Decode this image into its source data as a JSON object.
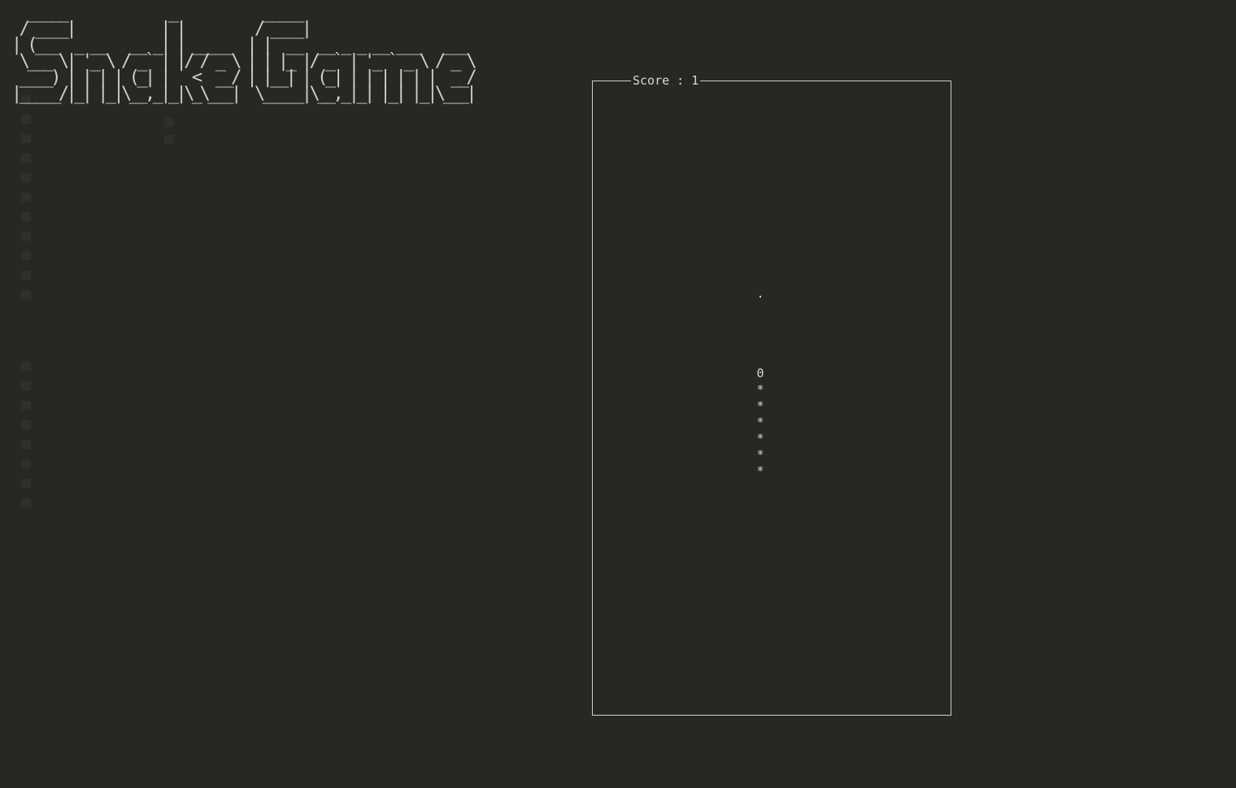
{
  "banner": {
    "ascii_art": "  _____             _           _____\n / ____|           | |         / ____|\n| (___  _ __   __ _| | _____  | |  __  __ _ _ __ ___   ___\n \\___ \\| '_ \\ / _` | |/ / _ \\ | | |_ |/ _` | '_ ` _ \\ / _ \\\n ____) | | | | (_| |   <  __/ | |__| | (_| | | | | | |  __/\n|_____/|_| |_|\\__,_|_|\\_\\___|  \\_____|\\__,_|_| |_| |_|\\___|"
  },
  "game": {
    "score_label": "Score : 1",
    "food_char": ".",
    "snake": {
      "head_char": "0",
      "body_char": "*",
      "body_length": 6
    }
  },
  "colors": {
    "background": "#272822",
    "foreground": "#d8d8d4"
  }
}
